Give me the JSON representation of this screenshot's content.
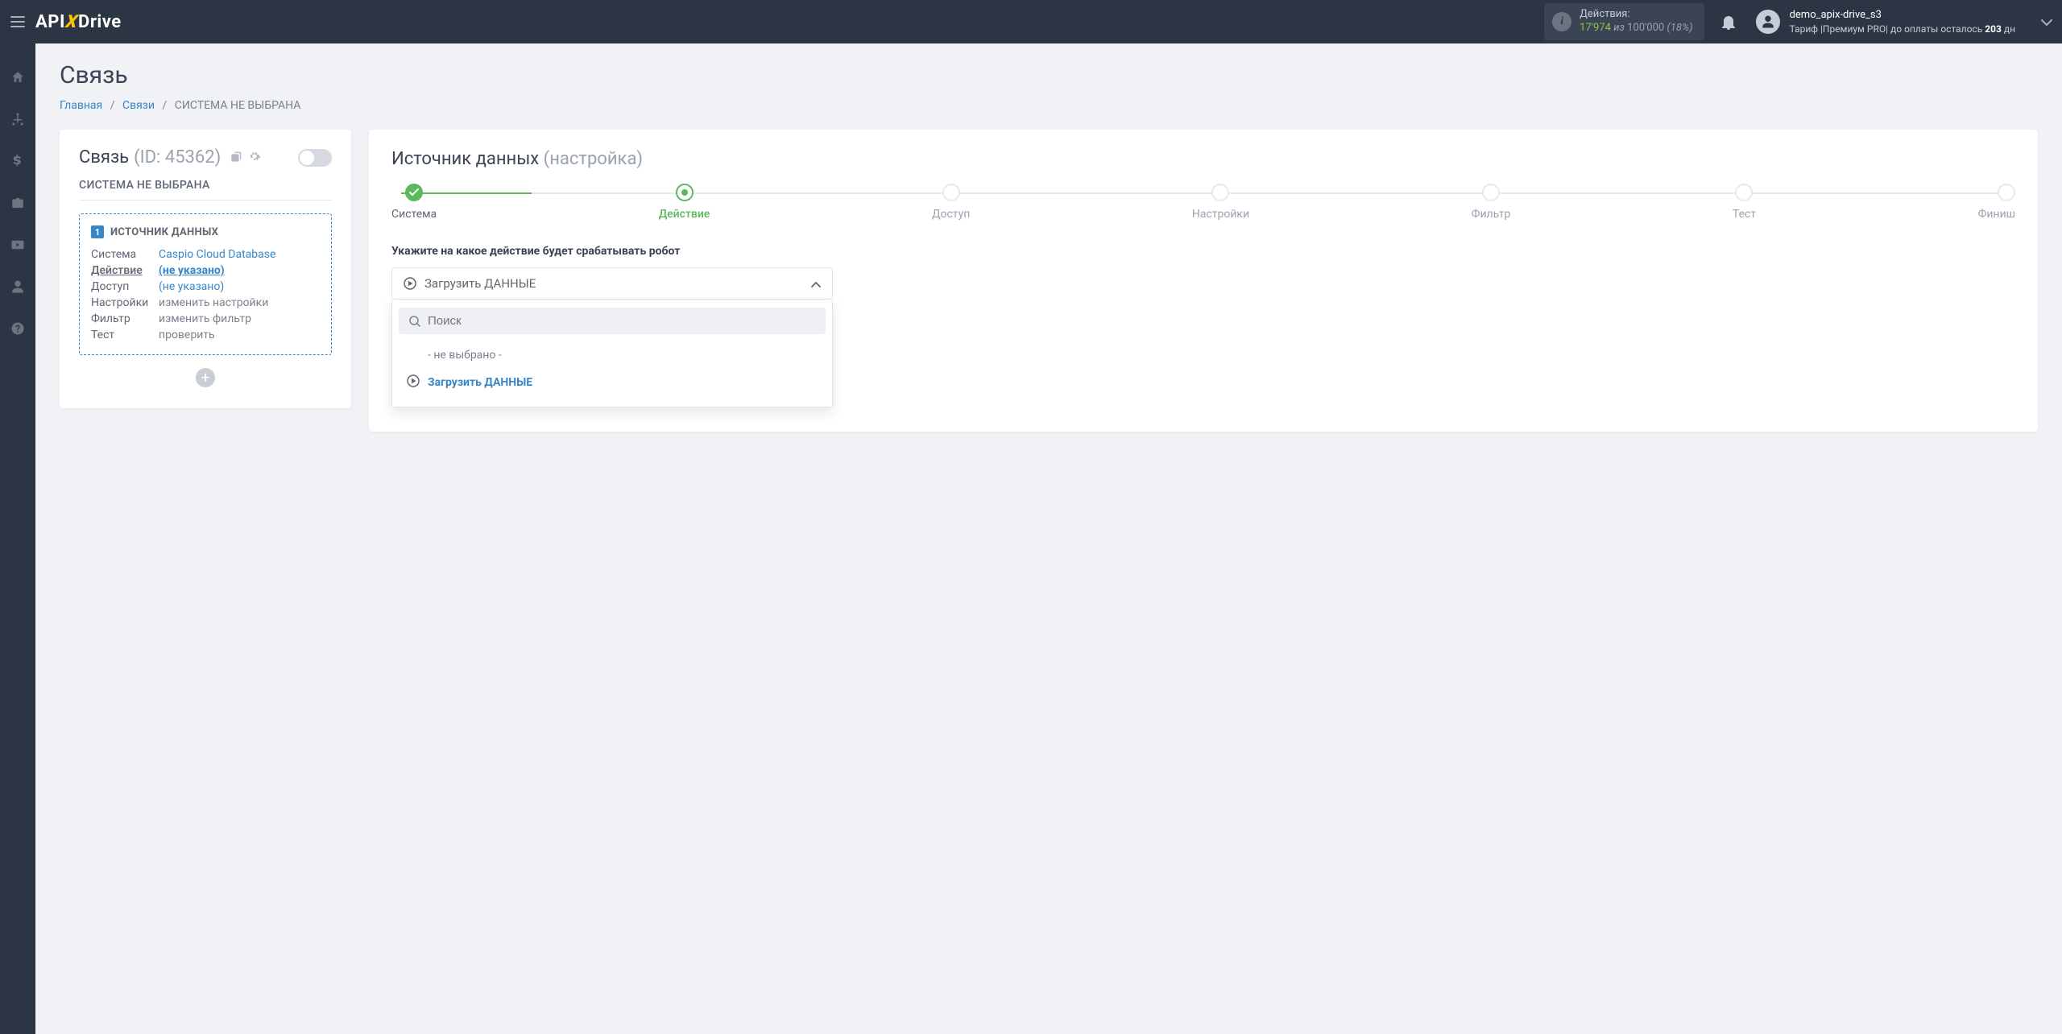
{
  "header": {
    "logo_api": "API",
    "logo_x": "X",
    "logo_drive": "Drive",
    "actions": {
      "label": "Действия:",
      "used": "17'974",
      "of": "из",
      "total": "100'000",
      "percent": "(18%)"
    },
    "user": {
      "name": "demo_apix-drive_s3",
      "tariff_prefix": "Тариф |Премиум PRO| до оплаты осталось ",
      "days_left": "203",
      "days_suffix": " дн"
    }
  },
  "page": {
    "title": "Связь",
    "breadcrumb": {
      "home": "Главная",
      "connections": "Связи",
      "current": "СИСТЕМА НЕ ВЫБРАНА"
    }
  },
  "left_card": {
    "title": "Связь",
    "id_label": "(ID: 45362)",
    "subtitle": "СИСТЕМА НЕ ВЫБРАНА",
    "source": {
      "num": "1",
      "heading": "ИСТОЧНИК ДАННЫХ",
      "rows": {
        "system_label": "Система",
        "system_value": "Caspio Cloud Database",
        "action_label": "Действие",
        "action_value": "(не указано)",
        "access_label": "Доступ",
        "access_value": "(не указано)",
        "settings_label": "Настройки",
        "settings_value": "изменить настройки",
        "filter_label": "Фильтр",
        "filter_value": "изменить фильтр",
        "test_label": "Тест",
        "test_value": "проверить"
      }
    }
  },
  "right_card": {
    "title_main": "Источник данных",
    "title_muted": "(настройка)",
    "steps": {
      "system": "Система",
      "action": "Действие",
      "access": "Доступ",
      "settings": "Настройки",
      "filter": "Фильтр",
      "test": "Тест",
      "finish": "Финиш"
    },
    "field_label": "Укажите на какое действие будет срабатывать робот",
    "select_value": "Загрузить ДАННЫЕ",
    "search_placeholder": "Поиск",
    "options": {
      "none": "- не выбрано -",
      "load_data": "Загрузить ДАННЫЕ"
    }
  }
}
